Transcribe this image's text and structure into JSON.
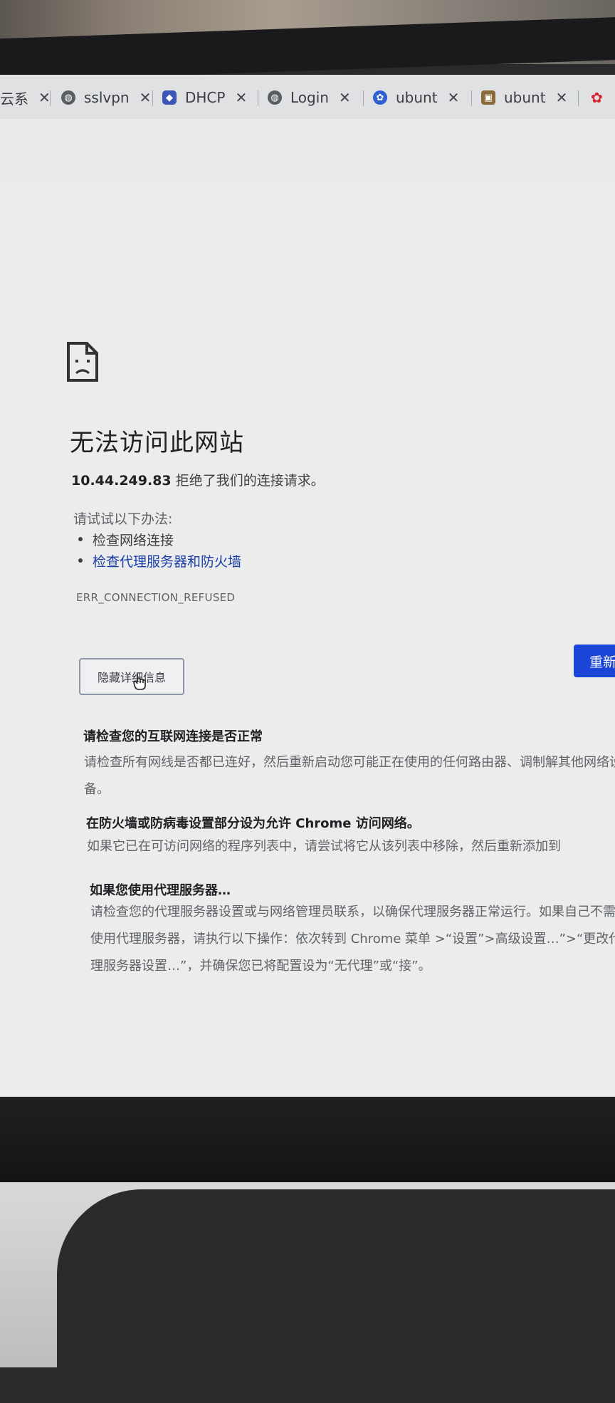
{
  "tabs": [
    {
      "label": "云系",
      "icon": "globe-icon"
    },
    {
      "label": "sslvpn",
      "icon": "globe-icon"
    },
    {
      "label": "DHCP",
      "icon": "shield-icon"
    },
    {
      "label": "Login",
      "icon": "globe-icon"
    },
    {
      "label": "ubunt",
      "icon": "paw-icon"
    },
    {
      "label": "ubunt",
      "icon": "app-icon"
    }
  ],
  "error": {
    "title": "无法访问此网站",
    "host": "10.44.249.83",
    "refused_text": "拒绝了我们的连接请求。",
    "try_label": "请试试以下办法:",
    "suggestions": [
      "检查网络连接",
      "检查代理服务器和防火墙"
    ],
    "code": "ERR_CONNECTION_REFUSED"
  },
  "buttons": {
    "details": "隐藏详细信息",
    "reload": "重新"
  },
  "details": [
    {
      "heading": "请检查您的互联网连接是否正常",
      "body": "请检查所有网线是否都已连好，然后重新启动您可能正在使用的任何路由器、调制解其他网络设备。"
    },
    {
      "heading": "在防火墙或防病毒设置部分设为允许 Chrome 访问网络。",
      "body": "如果它已在可访问网络的程序列表中，请尝试将它从该列表中移除，然后重新添加到"
    },
    {
      "heading": "如果您使用代理服务器…",
      "body": "请检查您的代理服务器设置或与网络管理员联系，以确保代理服务器正常运行。如果自己不需要使用代理服务器，请执行以下操作：依次转到 Chrome 菜单 >“设置”>高级设置…”>“更改代理服务器设置…”，并确保您已将配置设为“无代理”或“接”。"
    }
  ],
  "colors": {
    "link": "#1a3ea8",
    "reload_button": "#1a45d6"
  }
}
